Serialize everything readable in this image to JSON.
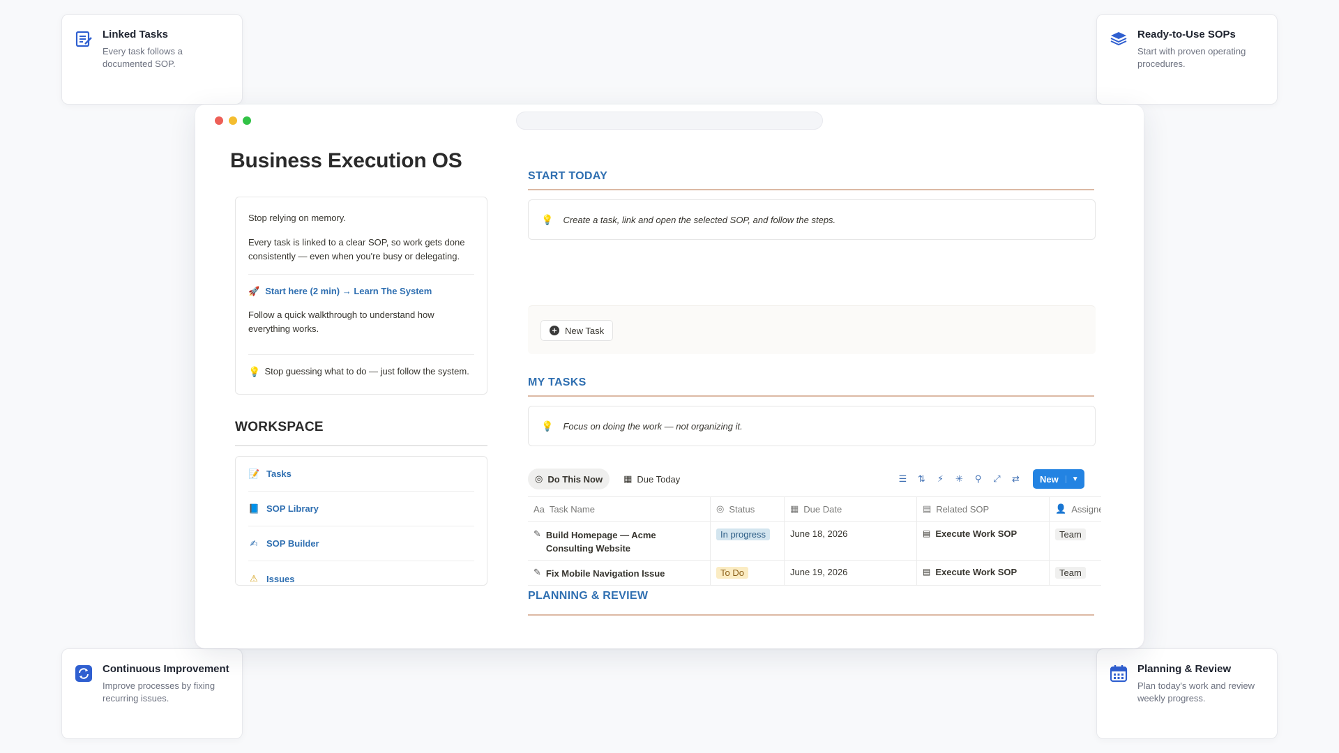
{
  "features": {
    "linked_tasks": {
      "title": "Linked Tasks",
      "desc": "Every task follows a documented SOP.",
      "icon": "checklist-icon"
    },
    "ready_sops": {
      "title": "Ready-to-Use SOPs",
      "desc": "Start with proven operating procedures.",
      "icon": "stack-icon"
    },
    "improvement": {
      "title": "Continuous Improvement",
      "desc": "Improve processes by fixing recurring issues.",
      "icon": "refresh-icon"
    },
    "planning": {
      "title": "Planning & Review",
      "desc": "Plan today's work and review weekly progress.",
      "icon": "calendar-icon"
    }
  },
  "page": {
    "title": "Business Execution OS"
  },
  "intro": {
    "line1": "Stop relying on memory.",
    "line2": "Every task is linked to a clear SOP, so work gets done consistently — even when you're busy or delegating.",
    "link": "Start here (2 min) → Learn The System",
    "walkthrough": "Follow  a quick walkthrough to understand how everything works.",
    "tip": "Stop guessing what to do — just follow the system."
  },
  "workspace": {
    "heading": "WORKSPACE",
    "items": [
      {
        "label": "Tasks",
        "icon": "📝"
      },
      {
        "label": "SOP Library",
        "icon": "📘"
      },
      {
        "label": "SOP Builder",
        "icon": "✍"
      },
      {
        "label": "Issues",
        "icon": "⚠"
      }
    ]
  },
  "start_today": {
    "heading": "START TODAY",
    "callout": "Create a task, link and open the selected SOP, and follow the steps.",
    "new_task": "New Task"
  },
  "my_tasks": {
    "heading": "MY TASKS",
    "callout": "Focus on doing the work — not organizing it.",
    "tabs": [
      "Do This Now",
      "Due Today"
    ],
    "new_button": "New",
    "columns": [
      "Task Name",
      "Status",
      "Due Date",
      "Related SOP",
      "Assigne"
    ],
    "column_icons": [
      "Aa",
      "◎",
      "▦",
      "▤",
      "👤"
    ],
    "rows": [
      {
        "name": "Build Homepage — Acme Consulting Website",
        "status": "In progress",
        "due": "June 18, 2026",
        "sop": "Execute Work SOP",
        "assignee": "Team"
      },
      {
        "name": "Fix Mobile Navigation Issue",
        "status": "To Do",
        "due": "June 19, 2026",
        "sop": "Execute Work SOP",
        "assignee": "Team"
      }
    ]
  },
  "planning": {
    "heading": "PLANNING & REVIEW"
  },
  "colors": {
    "accent": "#2f6fb1",
    "rule": "#dcb9a4",
    "new_button": "#2383e2",
    "feature_icon": "#2f5fd0"
  }
}
